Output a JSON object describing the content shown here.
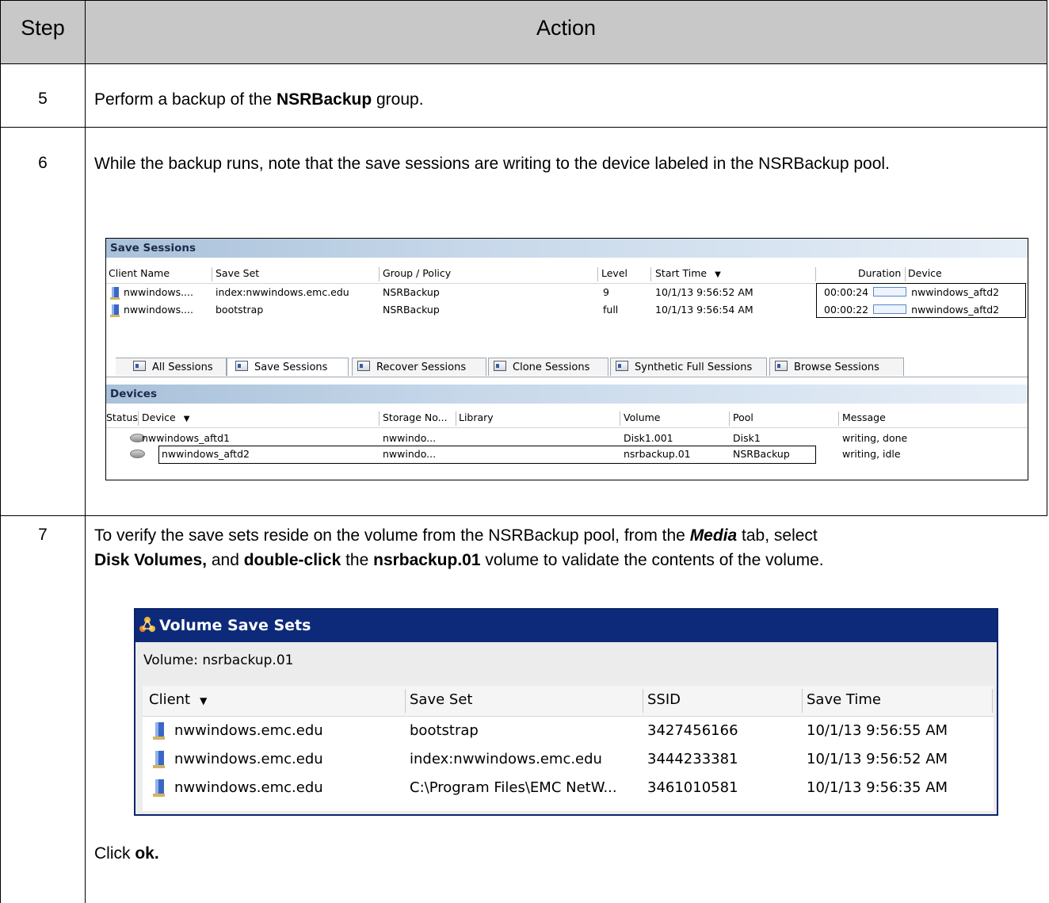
{
  "table": {
    "header_step": "Step",
    "header_action": "Action"
  },
  "rows": [
    {
      "step": "5",
      "text_parts": [
        "Perform a backup of the ",
        "NSRBackup",
        " group."
      ]
    },
    {
      "step": "6",
      "text": "While the backup runs, note that the save sessions are writing to the device labeled in the NSRBackup pool."
    },
    {
      "step": "7",
      "text_parts": [
        "To verify the save sets reside on the volume from the NSRBackup pool, from the ",
        "Media",
        " tab, select ",
        "Disk Volumes,",
        " and ",
        "double-click",
        " the ",
        "nsrbackup.01",
        " volume to validate the contents of the volume."
      ],
      "click_parts": [
        "Click ",
        "ok."
      ]
    }
  ],
  "sessions_panel": {
    "title": "Save Sessions",
    "columns": [
      "Client Name",
      "Save Set",
      "Group / Policy",
      "Level",
      "Start Time",
      "Duration",
      "Device"
    ],
    "rows": [
      {
        "client": "nwwindows....",
        "saveset": "index:nwwindows.emc.edu",
        "group": "NSRBackup",
        "level": "9",
        "start": "10/1/13 9:56:52 AM",
        "duration": "00:00:24",
        "device": "nwwindows_aftd2"
      },
      {
        "client": "nwwindows....",
        "saveset": "bootstrap",
        "group": "NSRBackup",
        "level": "full",
        "start": "10/1/13 9:56:54 AM",
        "duration": "00:00:22",
        "device": "nwwindows_aftd2"
      }
    ],
    "tabs": [
      "All Sessions",
      "Save Sessions",
      "Recover Sessions",
      "Clone Sessions",
      "Synthetic Full Sessions",
      "Browse Sessions"
    ],
    "active_tab": "Save Sessions"
  },
  "devices_panel": {
    "title": "Devices",
    "columns": [
      "Status",
      "Device",
      "Storage No...",
      "Library",
      "Volume",
      "Pool",
      "Message"
    ],
    "rows": [
      {
        "device": "nwwindows_aftd1",
        "storage": "nwwindo...",
        "library": "",
        "volume": "Disk1.001",
        "pool": "Disk1",
        "message": "writing, done"
      },
      {
        "device": "nwwindows_aftd2",
        "storage": "nwwindo...",
        "library": "",
        "volume": "nsrbackup.01",
        "pool": "NSRBackup",
        "message": "writing, idle"
      }
    ]
  },
  "volume_dialog": {
    "title": "Volume Save Sets",
    "volume_label": "Volume:  nsrbackup.01",
    "columns": [
      "Client",
      "Save Set",
      "SSID",
      "Save Time"
    ],
    "rows": [
      {
        "client": "nwwindows.emc.edu",
        "saveset": "bootstrap",
        "ssid": "3427456166",
        "time": "10/1/13 9:56:55 AM"
      },
      {
        "client": "nwwindows.emc.edu",
        "saveset": "index:nwwindows.emc.edu",
        "ssid": "3444233381",
        "time": "10/1/13 9:56:52 AM"
      },
      {
        "client": "nwwindows.emc.edu",
        "saveset": "C:\\Program Files\\EMC NetW...",
        "ssid": "3461010581",
        "time": "10/1/13 9:56:35 AM"
      }
    ]
  }
}
